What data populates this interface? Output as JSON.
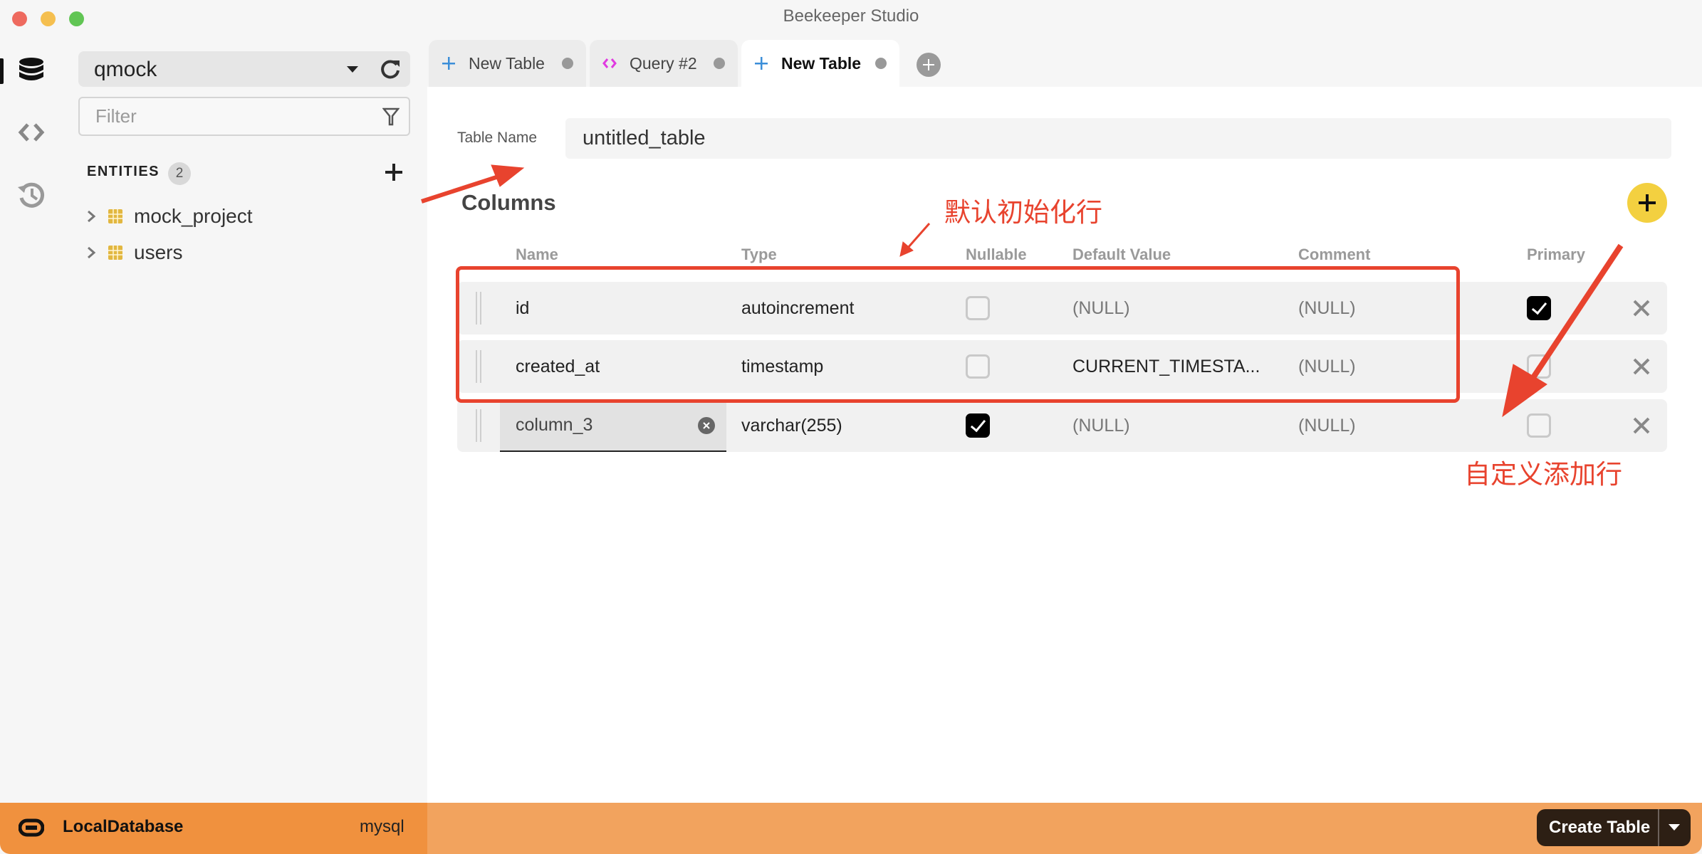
{
  "window": {
    "title": "Beekeeper Studio",
    "traffic_lights": [
      {
        "name": "close",
        "color": "#ee6a5f"
      },
      {
        "name": "minimize",
        "color": "#f5bf4f"
      },
      {
        "name": "zoom",
        "color": "#61c554"
      }
    ]
  },
  "activity_bar": {
    "items": [
      {
        "name": "database",
        "active": true
      },
      {
        "name": "query",
        "active": false
      },
      {
        "name": "history",
        "active": false
      }
    ]
  },
  "sidebar": {
    "database_select": {
      "value": "qmock"
    },
    "filter": {
      "placeholder": "Filter",
      "value": ""
    },
    "entities_label": "ENTITIES",
    "entities_count": "2",
    "entities": [
      {
        "label": "mock_project"
      },
      {
        "label": "users"
      }
    ]
  },
  "tabs": [
    {
      "label": "New Table",
      "icon": "plus-icon",
      "active": false
    },
    {
      "label": "Query #2",
      "icon": "code-icon",
      "active": false
    },
    {
      "label": "New Table",
      "icon": "plus-icon",
      "active": true
    }
  ],
  "editor": {
    "table_name_label": "Table Name",
    "table_name_value": "untitled_table",
    "columns_heading": "Columns",
    "headers": {
      "name": "Name",
      "type": "Type",
      "nullable": "Nullable",
      "default": "Default Value",
      "comment": "Comment",
      "primary": "Primary"
    },
    "rows": [
      {
        "name": "id",
        "type": "autoincrement",
        "nullable": false,
        "default": "(NULL)",
        "comment": "(NULL)",
        "primary": true
      },
      {
        "name": "created_at",
        "type": "timestamp",
        "nullable": false,
        "default": "CURRENT_TIMESTA...",
        "comment": "(NULL)",
        "primary": false
      },
      {
        "name": "column_3",
        "type": "varchar(255)",
        "nullable": true,
        "default": "(NULL)",
        "comment": "(NULL)",
        "primary": false
      }
    ]
  },
  "annotations": {
    "default_rows": "默认初始化行",
    "custom_row": "自定义添加行",
    "color": "#e8432e"
  },
  "status_bar": {
    "connection_name": "LocalDatabase",
    "connection_type": "mysql",
    "create_button": "Create Table",
    "colors": {
      "left": "#f0913e",
      "right": "#f2a35e"
    }
  }
}
